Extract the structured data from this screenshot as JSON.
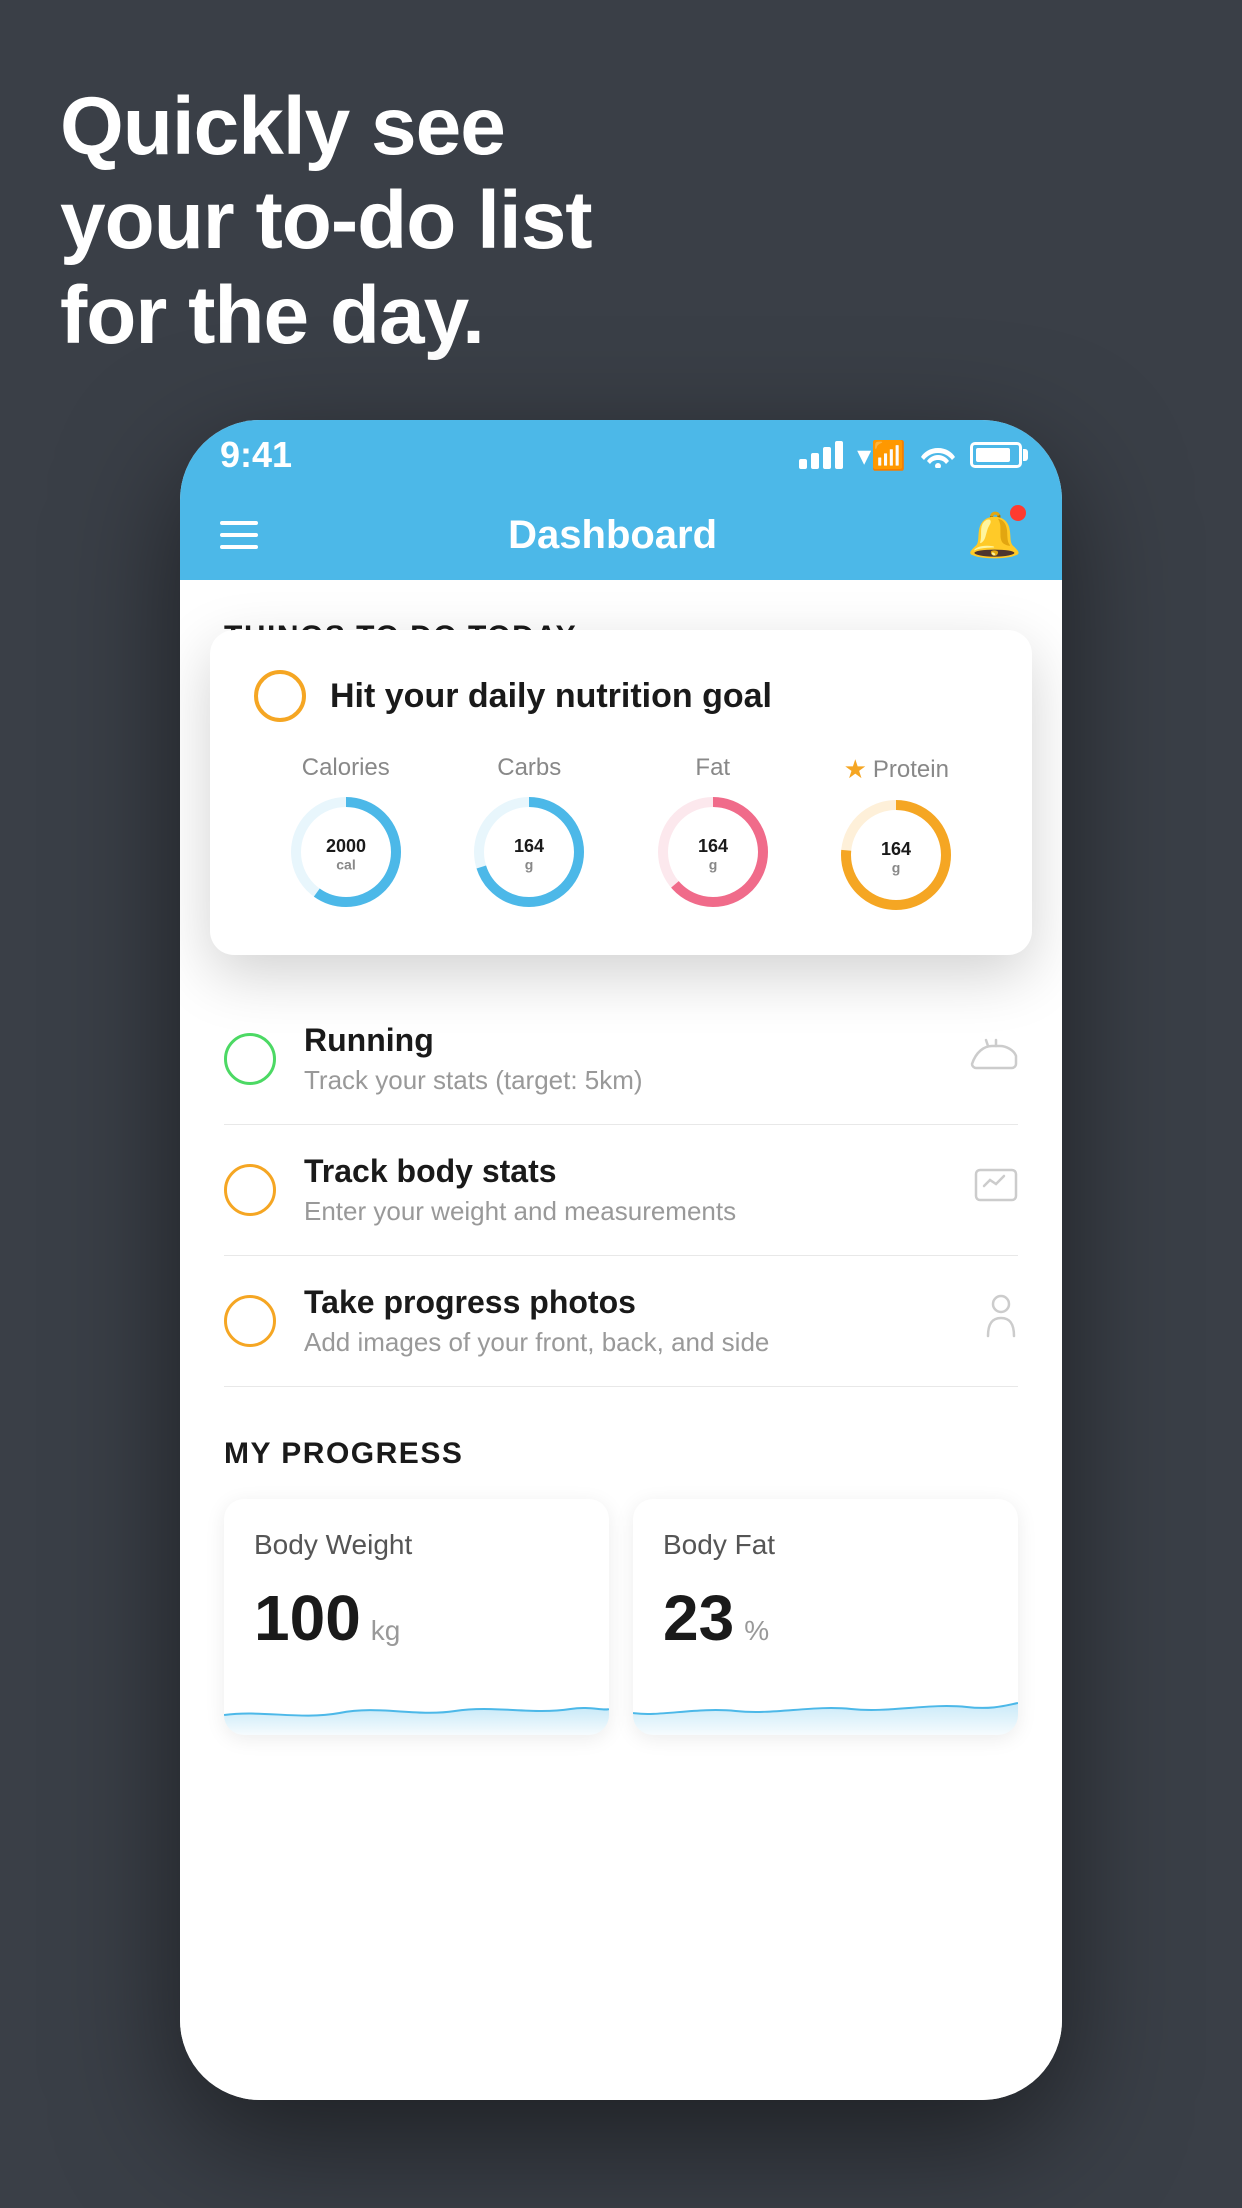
{
  "headline": {
    "line1": "Quickly see",
    "line2": "your to-do list",
    "line3": "for the day."
  },
  "statusBar": {
    "time": "9:41"
  },
  "navBar": {
    "title": "Dashboard"
  },
  "thingsToDo": {
    "sectionTitle": "THINGS TO DO TODAY"
  },
  "nutritionCard": {
    "title": "Hit your daily nutrition goal",
    "items": [
      {
        "label": "Calories",
        "value": "2000",
        "unit": "cal",
        "color": "#4cb8e8",
        "hasStar": false
      },
      {
        "label": "Carbs",
        "value": "164",
        "unit": "g",
        "color": "#4cb8e8",
        "hasStar": false
      },
      {
        "label": "Fat",
        "value": "164",
        "unit": "g",
        "color": "#f06b8a",
        "hasStar": false
      },
      {
        "label": "Protein",
        "value": "164",
        "unit": "g",
        "color": "#f5a623",
        "hasStar": true
      }
    ]
  },
  "todoItems": [
    {
      "title": "Running",
      "subtitle": "Track your stats (target: 5km)",
      "circleColor": "green",
      "icon": "shoe"
    },
    {
      "title": "Track body stats",
      "subtitle": "Enter your weight and measurements",
      "circleColor": "yellow",
      "icon": "scale"
    },
    {
      "title": "Take progress photos",
      "subtitle": "Add images of your front, back, and side",
      "circleColor": "yellow",
      "icon": "person"
    }
  ],
  "progressSection": {
    "title": "MY PROGRESS",
    "cards": [
      {
        "title": "Body Weight",
        "value": "100",
        "unit": "kg"
      },
      {
        "title": "Body Fat",
        "value": "23",
        "unit": "%"
      }
    ]
  }
}
